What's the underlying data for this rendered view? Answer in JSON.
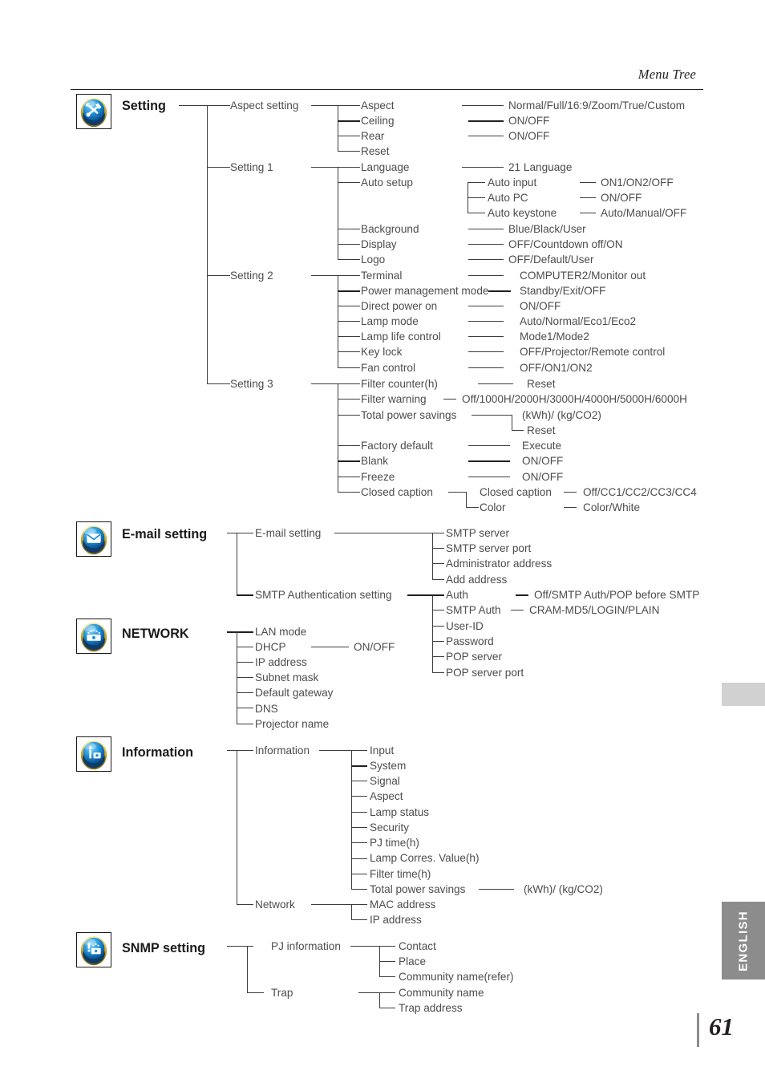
{
  "header": {
    "title": "Menu Tree"
  },
  "footer": {
    "page_number": "61",
    "language_tab": "ENGLISH"
  },
  "sections": [
    {
      "id": "setting",
      "icon": "tools-icon",
      "label": "Setting",
      "groups": [
        {
          "label": "Aspect setting"
        },
        {
          "label": "Setting 1"
        },
        {
          "label": "Setting 2"
        },
        {
          "label": "Setting 3"
        }
      ],
      "items": [
        {
          "label": "Aspect",
          "values": "Normal/Full/16:9/Zoom/True/Custom"
        },
        {
          "label": "Ceiling",
          "values": "ON/OFF"
        },
        {
          "label": "Rear",
          "values": "ON/OFF"
        },
        {
          "label": "Reset",
          "values": ""
        },
        {
          "label": "Language",
          "values": "21 Language"
        },
        {
          "label": "Auto setup",
          "values": ""
        },
        {
          "label": "Auto input",
          "values": "ON1/ON2/OFF"
        },
        {
          "label": "Auto PC",
          "values": "ON/OFF"
        },
        {
          "label": "Auto keystone",
          "values": "Auto/Manual/OFF"
        },
        {
          "label": "Background",
          "values": "Blue/Black/User"
        },
        {
          "label": "Display",
          "values": "OFF/Countdown off/ON"
        },
        {
          "label": "Logo",
          "values": "OFF/Default/User"
        },
        {
          "label": "Terminal",
          "values": "COMPUTER2/Monitor out"
        },
        {
          "label": "Power management mode",
          "values": "Standby/Exit/OFF"
        },
        {
          "label": "Direct power on",
          "values": "ON/OFF"
        },
        {
          "label": "Lamp mode",
          "values": "Auto/Normal/Eco1/Eco2"
        },
        {
          "label": "Lamp life control",
          "values": "Mode1/Mode2"
        },
        {
          "label": "Key lock",
          "values": "OFF/Projector/Remote control"
        },
        {
          "label": "Fan control",
          "values": "OFF/ON1/ON2"
        },
        {
          "label": "Filter counter(h)",
          "values": "Reset"
        },
        {
          "label": "Filter warning",
          "values": "Off/1000H/2000H/3000H/4000H/5000H/6000H"
        },
        {
          "label": "Total power savings",
          "values": "(kWh)/ (kg/CO2)"
        },
        {
          "label": "",
          "values": "Reset"
        },
        {
          "label": "Factory default",
          "values": "Execute"
        },
        {
          "label": "Blank",
          "values": "ON/OFF"
        },
        {
          "label": "Freeze",
          "values": "ON/OFF"
        },
        {
          "label": "Closed caption",
          "values": ""
        },
        {
          "label": "Closed caption",
          "values": "Off/CC1/CC2/CC3/CC4"
        },
        {
          "label": "Color",
          "values": "Color/White"
        }
      ]
    },
    {
      "id": "email-setting",
      "icon": "envelope-icon",
      "label": "E-mail setting",
      "groups": [
        {
          "label": "E-mail setting"
        },
        {
          "label": "SMTP Authentication setting"
        }
      ],
      "items": [
        {
          "label": "SMTP server",
          "values": ""
        },
        {
          "label": "SMTP server port",
          "values": ""
        },
        {
          "label": "Administrator address",
          "values": ""
        },
        {
          "label": "Add address",
          "values": ""
        },
        {
          "label": "Auth",
          "values": "Off/SMTP Auth/POP before SMTP"
        },
        {
          "label": "SMTP Auth",
          "values": "CRAM-MD5/LOGIN/PLAIN"
        },
        {
          "label": "User-ID",
          "values": ""
        },
        {
          "label": "Password",
          "values": ""
        },
        {
          "label": "POP server",
          "values": ""
        },
        {
          "label": "POP server port",
          "values": ""
        }
      ]
    },
    {
      "id": "network",
      "icon": "network-icon",
      "label": "NETWORK",
      "groups": [],
      "items": [
        {
          "label": "LAN mode",
          "values": ""
        },
        {
          "label": "DHCP",
          "values": "ON/OFF"
        },
        {
          "label": "IP address",
          "values": ""
        },
        {
          "label": "Subnet mask",
          "values": ""
        },
        {
          "label": "Default gateway",
          "values": ""
        },
        {
          "label": "DNS",
          "values": ""
        },
        {
          "label": "Projector name",
          "values": ""
        }
      ]
    },
    {
      "id": "information",
      "icon": "info-icon",
      "label": "Information",
      "groups": [
        {
          "label": "Information"
        },
        {
          "label": "Network"
        }
      ],
      "items": [
        {
          "label": "Input",
          "values": ""
        },
        {
          "label": "System",
          "values": ""
        },
        {
          "label": "Signal",
          "values": ""
        },
        {
          "label": "Aspect",
          "values": ""
        },
        {
          "label": "Lamp status",
          "values": ""
        },
        {
          "label": "Security",
          "values": ""
        },
        {
          "label": "PJ time(h)",
          "values": ""
        },
        {
          "label": "Lamp Corres. Value(h)",
          "values": ""
        },
        {
          "label": "Filter time(h)",
          "values": ""
        },
        {
          "label": "Total power savings",
          "values": "(kWh)/ (kg/CO2)"
        },
        {
          "label": "MAC address",
          "values": ""
        },
        {
          "label": "IP address",
          "values": ""
        }
      ]
    },
    {
      "id": "snmp-setting",
      "icon": "snmp-icon",
      "label": "SNMP setting",
      "groups": [
        {
          "label": "PJ information"
        },
        {
          "label": "Trap"
        }
      ],
      "items": [
        {
          "label": "Contact",
          "values": ""
        },
        {
          "label": "Place",
          "values": ""
        },
        {
          "label": "Community name(refer)",
          "values": ""
        },
        {
          "label": "Community name",
          "values": ""
        },
        {
          "label": "Trap address",
          "values": ""
        }
      ]
    }
  ],
  "colors": {
    "text": "#4d4d4d",
    "heading": "#1a1a1a",
    "rule": "#231f20",
    "tab_active": "#8c8c8c",
    "tab_blank": "#d1d1d1"
  }
}
